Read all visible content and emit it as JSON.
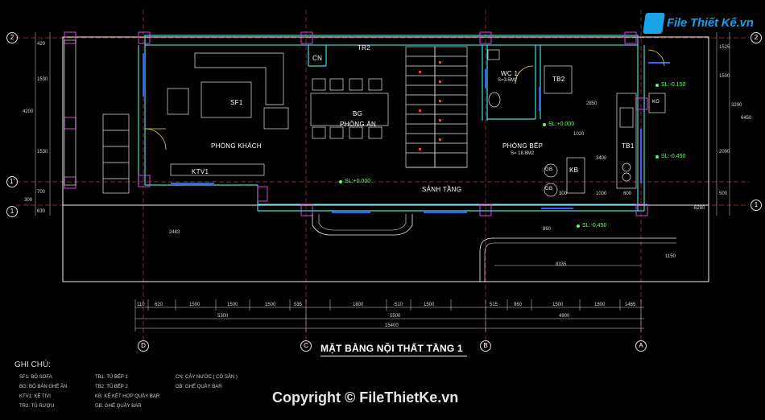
{
  "title": "MẶT BẰNG NỘI THẤT TẦNG 1",
  "logo_text": "File Thiết Kế.vn",
  "copyright": "Copyright © FileThietKe.vn",
  "rooms": {
    "living": "PHÒNG KHÁCH",
    "dining_code": "BG",
    "dining": "PHÒNG ĂN",
    "hall": "SẢNH TẦNG",
    "kitchen": "PHÒNG BẾP",
    "kitchen_area": "S= 18.8M2",
    "wc": "WC 1",
    "wc_area": "S=3.5M2",
    "sofa": "SF1",
    "tv": "KTV1",
    "cn": "CN",
    "tr2": "TR2",
    "tb1": "TB1",
    "tb2": "TB2",
    "kb": "KB",
    "gb1": "GB",
    "gb2": "GB",
    "kg": "KG"
  },
  "levels": {
    "sl_hall": "SL:+0.000",
    "sl_kitchen": "SL:+0.000",
    "sl_back1": "SL:-0.150",
    "sl_back2": "SL:-0.450",
    "sl_front": "SL:-0.450"
  },
  "axes": {
    "bottom": [
      "D",
      "C",
      "B",
      "A"
    ],
    "left": [
      "2",
      "1'",
      "1"
    ],
    "right": [
      "2",
      "1"
    ]
  },
  "dimensions": {
    "bottom_row1": [
      "110",
      "620",
      "1500",
      "1500",
      "1500",
      "535",
      "1800",
      "510",
      "1500",
      "515",
      "960",
      "1500",
      "1800",
      "1465"
    ],
    "bottom_row2": [
      "5300",
      "5500",
      "4900"
    ],
    "bottom_total": "15400",
    "left": [
      "420",
      "1530",
      "4200",
      "1530",
      "700",
      "300",
      "630"
    ],
    "right": [
      "1525",
      "1500",
      "3290",
      "2000",
      "500",
      "6280",
      "6450"
    ],
    "inner": [
      "2850",
      "1020",
      "1000",
      "600",
      "300",
      "3400",
      "2483",
      "8335",
      "1150",
      "860"
    ]
  },
  "legend": {
    "heading": "GHI CHÚ:",
    "col1": [
      "SF1: BỘ SOFA",
      "BG: BỘ BÀN GHẾ ĂN",
      "KTV1: KỆ TIVI",
      "TR2: TỦ RƯỢU"
    ],
    "col2": [
      "TB1: TỦ BẾP 1",
      "TB2: TỦ BẾP 2",
      "KB: KỆ KẾT HỢP QUẦY BAR",
      "GB: GHẾ QUẦY BAR"
    ],
    "col3": [
      "CN: CÂY NƯỚC ( CÓ SẴN )",
      "GB: GHẾ QUẦY BAR"
    ]
  }
}
